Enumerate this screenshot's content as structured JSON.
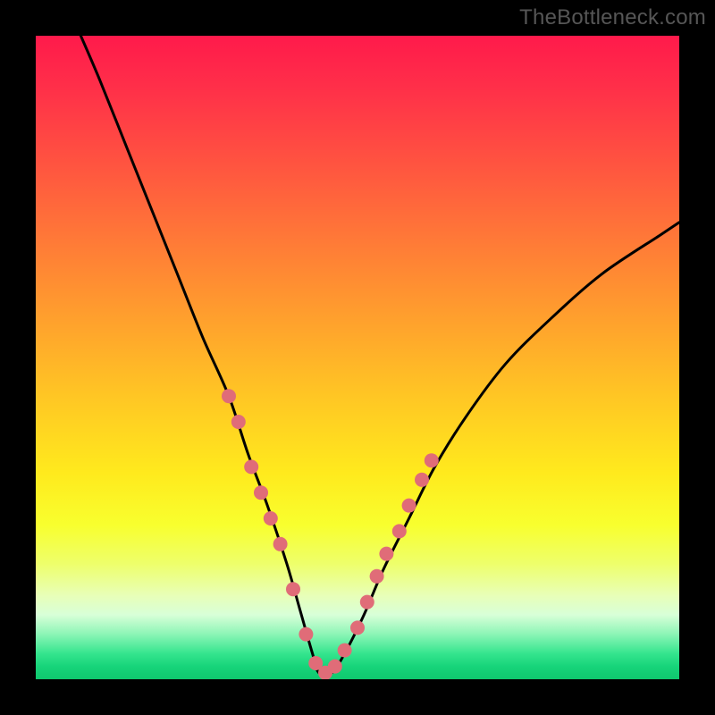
{
  "watermark": "TheBottleneck.com",
  "colors": {
    "frame": "#000000",
    "watermark_text": "#565656",
    "curve": "#000000",
    "dots": "#e06c78",
    "gradient_top": "#ff1a4b",
    "gradient_mid": "#ffea1d",
    "gradient_bottom": "#0fc86e"
  },
  "chart_data": {
    "type": "line",
    "title": "",
    "xlabel": "",
    "ylabel": "",
    "xlim": [
      0,
      100
    ],
    "ylim": [
      0,
      100
    ],
    "notes": "Bottleneck-style V-curve. y is a percentage-like score that drops to ~0 near x≈44 then rises again. Background is a vertical spectral gradient (red→yellow→green) keyed to y. Dots are sample markers along the curve.",
    "series": [
      {
        "name": "curve",
        "x": [
          7,
          10,
          14,
          18,
          22,
          26,
          30,
          33,
          36,
          39,
          41,
          43,
          44,
          46,
          48,
          51,
          54,
          58,
          62,
          67,
          73,
          80,
          88,
          97,
          100
        ],
        "y": [
          100,
          93,
          83,
          73,
          63,
          53,
          44,
          35,
          27,
          18,
          11,
          4,
          1,
          1,
          4,
          10,
          17,
          25,
          33,
          41,
          49,
          56,
          63,
          69,
          71
        ]
      }
    ],
    "dots": {
      "name": "markers",
      "x": [
        30,
        31.5,
        33.5,
        35,
        36.5,
        38,
        40,
        42,
        43.5,
        45,
        46.5,
        48,
        50,
        51.5,
        53,
        54.5,
        56.5,
        58,
        60,
        61.5
      ],
      "y": [
        44,
        40,
        33,
        29,
        25,
        21,
        14,
        7,
        2.5,
        1,
        2,
        4.5,
        8,
        12,
        16,
        19.5,
        23,
        27,
        31,
        34
      ]
    }
  }
}
